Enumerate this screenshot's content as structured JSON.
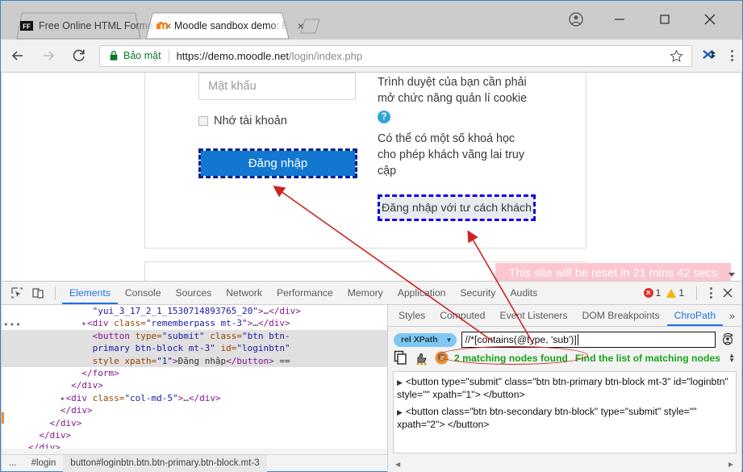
{
  "window": {
    "controls": {
      "profile": "profile-avatar",
      "minimize": "—",
      "maximize": "□",
      "close": "×"
    }
  },
  "tabs": [
    {
      "title": "Free Online HTML Format",
      "favicon": "FF",
      "active": false,
      "close": "×"
    },
    {
      "title": "Moodle sandbox demo: E",
      "favicon": "moodle-m",
      "active": true,
      "close": "×"
    }
  ],
  "toolbar": {
    "back": "←",
    "forward": "→",
    "reload": "C",
    "secure_label": "Bảo mật",
    "url_domain": "https://demo.moodle.net",
    "url_path": "/login/index.php",
    "star": "☆",
    "extension": "chropath-extension",
    "menu": "⋮"
  },
  "page": {
    "password_placeholder": "Mật khẩu",
    "remember_label": "Nhớ tài khoản",
    "login_button": "Đăng nhập",
    "cookie_text": "Trình duyệt của bạn cần phải mở chức năng quản lí cookie",
    "help_icon": "?",
    "guest_text": "Có thể có một số khoá học cho phép khách vãng lai truy cập",
    "guest_button": "Đăng nhập với tư cách khách",
    "reset_banner": "This site will be reset in 21 mins 42 secs"
  },
  "devtools": {
    "tabs": [
      {
        "label": "Elements",
        "active": true
      },
      {
        "label": "Console",
        "active": false
      },
      {
        "label": "Sources",
        "active": false
      },
      {
        "label": "Network",
        "active": false
      },
      {
        "label": "Performance",
        "active": false
      },
      {
        "label": "Memory",
        "active": false
      },
      {
        "label": "Application",
        "active": false
      },
      {
        "label": "Security",
        "active": false
      },
      {
        "label": "Audits",
        "active": false
      }
    ],
    "error_count": "1",
    "warning_count": "1",
    "menu": "⋮",
    "close": "✕",
    "dom_lines": [
      {
        "indent": 17,
        "parts": [
          {
            "c": "val",
            "t": "\"yui_3_17_2_1_1530714893765_20\""
          },
          {
            "c": "tag",
            "t": ">"
          },
          {
            "c": "txt",
            "t": "…"
          },
          {
            "c": "tag",
            "t": "</div>"
          }
        ],
        "selected": false
      },
      {
        "indent": 15,
        "parts": [
          {
            "c": "arrow",
            "t": "▸"
          },
          {
            "c": "tag",
            "t": "<div "
          },
          {
            "c": "attr",
            "t": "class="
          },
          {
            "c": "val",
            "t": "\"rememberpass mt-3\""
          },
          {
            "c": "tag",
            "t": ">"
          },
          {
            "c": "txt",
            "t": "…"
          },
          {
            "c": "tag",
            "t": "</div>"
          }
        ],
        "selected": false
      },
      {
        "indent": 17,
        "parts": [
          {
            "c": "tag",
            "t": "<button "
          },
          {
            "c": "attr",
            "t": "type="
          },
          {
            "c": "val",
            "t": "\"submit\""
          },
          {
            "c": "attr",
            "t": " class="
          },
          {
            "c": "val",
            "t": "\"btn btn-"
          }
        ],
        "selected": true
      },
      {
        "indent": 17,
        "parts": [
          {
            "c": "val",
            "t": "primary btn-block mt-3\""
          },
          {
            "c": "attr",
            "t": " id="
          },
          {
            "c": "val",
            "t": "\"loginbtn\""
          }
        ],
        "selected": true
      },
      {
        "indent": 17,
        "parts": [
          {
            "c": "attr",
            "t": "style xpath="
          },
          {
            "c": "val",
            "t": "\"1\""
          },
          {
            "c": "tag",
            "t": ">"
          },
          {
            "c": "txt",
            "t": "Đăng nhập"
          },
          {
            "c": "tag",
            "t": "</button>"
          },
          {
            "c": "txt",
            "t": " == "
          }
        ],
        "selected": true
      },
      {
        "indent": 15,
        "parts": [
          {
            "c": "tag",
            "t": "</form>"
          }
        ],
        "selected": false
      },
      {
        "indent": 13,
        "parts": [
          {
            "c": "tag",
            "t": "</div>"
          }
        ],
        "selected": false
      },
      {
        "indent": 11,
        "parts": [
          {
            "c": "arrow",
            "t": "▸"
          },
          {
            "c": "tag",
            "t": "<div "
          },
          {
            "c": "attr",
            "t": "class="
          },
          {
            "c": "val",
            "t": "\"col-md-5\""
          },
          {
            "c": "tag",
            "t": ">"
          },
          {
            "c": "txt",
            "t": "…"
          },
          {
            "c": "tag",
            "t": "</div>"
          }
        ],
        "selected": false
      },
      {
        "indent": 11,
        "parts": [
          {
            "c": "tag",
            "t": "</div>"
          }
        ],
        "selected": false
      },
      {
        "indent": 9,
        "parts": [
          {
            "c": "tag",
            "t": "</div>"
          }
        ],
        "selected": false
      },
      {
        "indent": 7,
        "parts": [
          {
            "c": "tag",
            "t": "</div>"
          }
        ],
        "selected": false
      },
      {
        "indent": 5,
        "parts": [
          {
            "c": "tag",
            "t": "</div>"
          }
        ],
        "selected": false
      }
    ],
    "breadcrumb": [
      {
        "label": "...",
        "active": false
      },
      {
        "label": "#login",
        "active": false
      },
      {
        "label": "button#loginbtn.btn.btn-primary.btn-block.mt-3",
        "active": true
      }
    ]
  },
  "sidepanel": {
    "tabs": [
      {
        "label": "Styles",
        "active": false
      },
      {
        "label": "Computed",
        "active": false
      },
      {
        "label": "Event Listeners",
        "active": false
      },
      {
        "label": "DOM Breakpoints",
        "active": false
      },
      {
        "label": "ChroPath",
        "active": true
      }
    ],
    "more": "»",
    "chropath": {
      "selector_type": "rel XPath",
      "selector_caret": "▼",
      "xpath_value": "//*[contains(@type, 'sub')]",
      "reload_icon": "user-rotate-icon",
      "copy_icon": "copy-icon",
      "rate_icon": "rate-icon",
      "firefox_icon": "firefox-icon",
      "found_text": "2 matching nodes found",
      "hint_text": "Find the list of matching nodes",
      "spinner": "↕",
      "results": [
        "<button type=\"submit\" class=\"btn btn-primary btn-block mt-3\" id=\"loginbtn\" style=\"\" xpath=\"1\"> </button>",
        "<button class=\"btn btn-secondary btn-block\" type=\"submit\" style=\"\" xpath=\"2\"> </button>"
      ]
    }
  }
}
